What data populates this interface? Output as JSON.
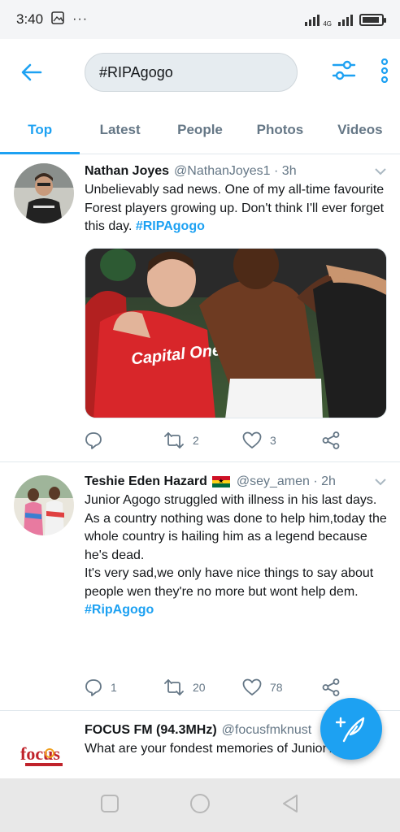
{
  "status_bar": {
    "time": "3:40",
    "network": "4G",
    "battery_level": 0.9
  },
  "search": {
    "query": "#RIPAgogo"
  },
  "tabs": [
    {
      "label": "Top",
      "active": true
    },
    {
      "label": "Latest",
      "active": false
    },
    {
      "label": "People",
      "active": false
    },
    {
      "label": "Photos",
      "active": false
    },
    {
      "label": "Videos",
      "active": false
    }
  ],
  "tweets": [
    {
      "name": "Nathan Joyes",
      "handle": "@NathanJoyes1",
      "time": "3h",
      "text": "Unbelievably sad news. One of my all-time favourite Forest players growing up. Don't think I'll ever forget this day. ",
      "hashtag": "#RIPAgogo",
      "media_caption": "Capital One",
      "replies": "",
      "retweets": "2",
      "likes": "3"
    },
    {
      "name": "Teshie Eden Hazard",
      "handle": "@sey_amen",
      "time": "2h",
      "lines": [
        "Junior Agogo struggled with illness in his last days.",
        "As a country nothing was done to help him,today the whole country is hailing him as a legend because he's dead.",
        "It's very sad,we only have nice things to say about people wen they're no more but wont help dem."
      ],
      "hashtag": "#RipAgogo",
      "replies": "1",
      "retweets": "20",
      "likes": "78"
    },
    {
      "name": "FOCUS FM (94.3MHz)",
      "handle": "@focusfmknust",
      "text": "What are your fondest memories of Junior Agogo?",
      "avatar_logo": "focus"
    }
  ],
  "colors": {
    "accent": "#1da1f2",
    "muted": "#657786"
  }
}
